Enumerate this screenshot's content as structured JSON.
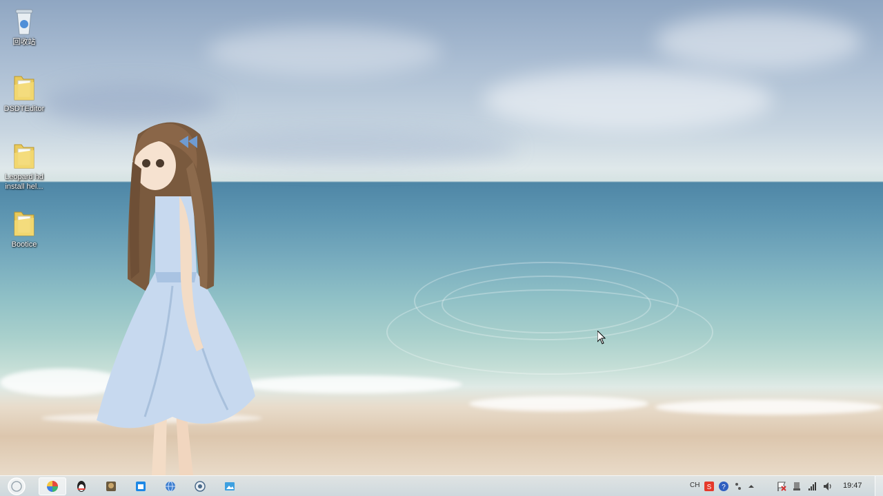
{
  "desktop": {
    "icons": [
      {
        "label": "回收站",
        "icon": "recycle-bin-icon"
      },
      {
        "label": "DSDTEditor",
        "icon": "folder-icon"
      },
      {
        "label": "Leopard hd install hel...",
        "icon": "folder-icon"
      },
      {
        "label": "Bootice",
        "icon": "folder-icon"
      }
    ]
  },
  "taskbar": {
    "pinned": [
      {
        "icon": "color-picker-app-icon",
        "active": true
      },
      {
        "icon": "qq-penguin-icon",
        "active": false
      },
      {
        "icon": "game-app-icon",
        "active": false
      },
      {
        "icon": "store-app-icon",
        "active": false
      },
      {
        "icon": "browser-globe-icon",
        "active": false
      },
      {
        "icon": "media-player-icon",
        "active": false
      },
      {
        "icon": "image-viewer-icon",
        "active": false
      }
    ],
    "tray": {
      "language": "CH",
      "icons": [
        "sogou-input-icon",
        "help-icon",
        "punctuation-icon",
        "show-hidden-icons-arrow",
        "action-center-flag-icon",
        "usb-eject-icon",
        "network-signal-icon",
        "volume-icon"
      ],
      "clock": "19:47"
    }
  },
  "colors": {
    "taskbar": "#cfdde4",
    "active_tab": "#ffffff"
  }
}
